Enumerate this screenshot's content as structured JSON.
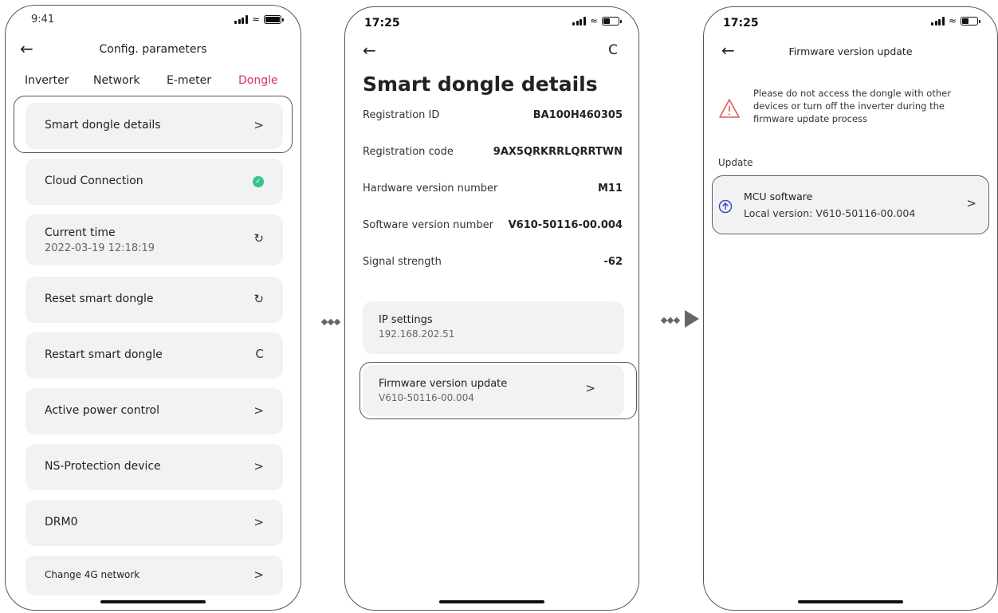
{
  "phone1": {
    "time": "9:41",
    "title": "Config. parameters",
    "tabs": [
      "Inverter",
      "Network",
      "E-meter",
      "Dongle"
    ],
    "items": [
      {
        "label": "Smart dongle details",
        "right": ">"
      },
      {
        "label": "Cloud Connection"
      },
      {
        "label": "Current time",
        "sub": "2022-03-19 12:18:19",
        "right": "↻"
      },
      {
        "label": "Reset smart dongle",
        "right": "↻"
      },
      {
        "label": "Restart smart dongle",
        "right": "C"
      },
      {
        "label": "Active power control",
        "right": ">"
      },
      {
        "label": "NS-Protection device",
        "right": ">"
      },
      {
        "label": "DRM0",
        "right": ">"
      },
      {
        "label": "Change 4G network",
        "right": ">"
      }
    ]
  },
  "phone2": {
    "time": "17:25",
    "refresh": "C",
    "title": "Smart dongle details",
    "rows": [
      {
        "k": "Registration ID",
        "v": "BA100H460305"
      },
      {
        "k": "Registration code",
        "v": "9AX5QRKRRLQRRTWN"
      },
      {
        "k": "Hardware version number",
        "v": "M11"
      },
      {
        "k": "Software version number",
        "v": "V610-50116-00.004"
      },
      {
        "k": "Signal strength",
        "v": "-62"
      }
    ],
    "ip": {
      "label": "IP settings",
      "value": "192.168.202.51"
    },
    "fw": {
      "label": "Firmware version update",
      "value": "V610-50116-00.004",
      "right": ">"
    }
  },
  "phone3": {
    "time": "17:25",
    "title": "Firmware version update",
    "warning": "Please do not access the dongle with other devices or turn off the inverter during the firmware update process",
    "section": "Update",
    "item": {
      "label": "MCU software",
      "sub": "Local version: V610-50116-00.004",
      "right": ">"
    }
  },
  "icons": {
    "back": "arrow-left-icon",
    "warning": "warning-triangle-icon",
    "upload": "arrow-up-circle-icon",
    "check": "check-circle-icon",
    "sync": "sync-icon",
    "refresh": "refresh-icon"
  },
  "colors": {
    "accent": "#d6336c",
    "card": "#f1f2f4",
    "success": "#35c58c",
    "warning": "#e05a5a",
    "upload": "#3a4fb8"
  }
}
